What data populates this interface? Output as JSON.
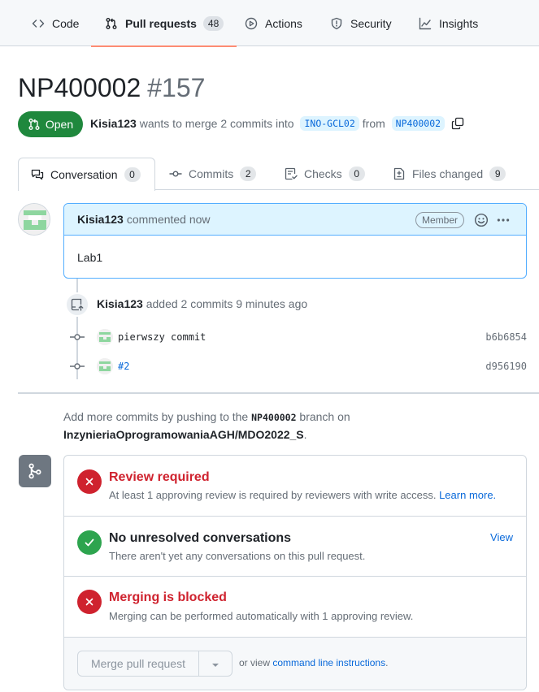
{
  "repo_nav": {
    "tabs": [
      {
        "label": "Code",
        "icon": "code-icon"
      },
      {
        "label": "Pull requests",
        "icon": "git-pull-request-icon",
        "count": "48",
        "active": true
      },
      {
        "label": "Actions",
        "icon": "play-icon"
      },
      {
        "label": "Security",
        "icon": "shield-icon"
      },
      {
        "label": "Insights",
        "icon": "graph-icon"
      }
    ]
  },
  "pr": {
    "title": "NP400002",
    "number": "#157",
    "state": "Open",
    "author": "Kisia123",
    "meta_text": "wants to merge 2 commits into",
    "base_branch": "INO-GCL02",
    "from_text": "from",
    "head_branch": "NP400002"
  },
  "pr_tabs": [
    {
      "label": "Conversation",
      "count": "0",
      "icon": "comment-discussion-icon",
      "active": true
    },
    {
      "label": "Commits",
      "count": "2",
      "icon": "git-commit-icon"
    },
    {
      "label": "Checks",
      "count": "0",
      "icon": "checklist-icon"
    },
    {
      "label": "Files changed",
      "count": "9",
      "icon": "file-diff-icon"
    }
  ],
  "comment": {
    "author": "Kisia123",
    "action": "commented now",
    "role": "Member",
    "body": "Lab1"
  },
  "push_event": {
    "author": "Kisia123",
    "text": "added 2 commits 9 minutes ago",
    "commits": [
      {
        "message": "pierwszy commit",
        "sha": "b6b6854",
        "is_link": false
      },
      {
        "message": "#2",
        "sha": "d956190",
        "is_link": true
      }
    ]
  },
  "hint": {
    "prefix": "Add more commits by pushing to the",
    "branch": "NP400002",
    "middle": "branch on",
    "repo": "InzynieriaOprogramowaniaAGH/MDO2022_S",
    "suffix": "."
  },
  "merge_box": {
    "review": {
      "title": "Review required",
      "desc": "At least 1 approving review is required by reviewers with write access.",
      "link": "Learn more."
    },
    "conversations": {
      "title": "No unresolved conversations",
      "desc": "There aren't yet any conversations on this pull request.",
      "link": "View"
    },
    "blocked": {
      "title": "Merging is blocked",
      "desc": "Merging can be performed automatically with 1 approving review."
    },
    "merge_button": "Merge pull request",
    "cli_prefix": "or view",
    "cli_link": "command line instructions",
    "cli_suffix": "."
  },
  "colors": {
    "open_green": "#1f883d",
    "danger_red": "#cf222e",
    "success_green": "#2da44e",
    "link_blue": "#0969da",
    "accent_underline": "#fd8c73"
  }
}
